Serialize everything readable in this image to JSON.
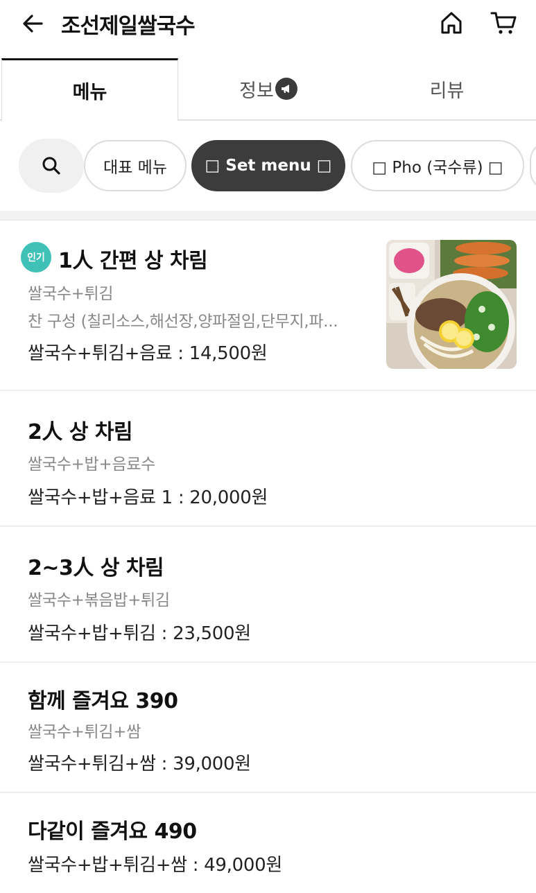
{
  "header": {
    "title": "조선제일쌀국수",
    "back_icon": "arrow-left-icon",
    "home_icon": "home-icon",
    "cart_icon": "cart-icon"
  },
  "tabs": [
    {
      "label": "메뉴",
      "active": true
    },
    {
      "label": "정보",
      "active": false,
      "icon": "megaphone-icon"
    },
    {
      "label": "리뷰",
      "active": false
    }
  ],
  "categories": {
    "search_icon": "search-icon",
    "chips": [
      {
        "label": "대표 메뉴",
        "selected": false
      },
      {
        "label": "□ Set menu □",
        "selected": true
      },
      {
        "label": "□ Pho (국수류) □",
        "selected": false
      }
    ]
  },
  "menu_items": [
    {
      "badge": "인기",
      "name": "1人 간편 상 차림",
      "desc_1": "쌀국수+튀김",
      "desc_2": "찬 구성 (칠리소스,해선장,양파절임,단무지,파...",
      "price": "쌀국수+튀김+음료 : 14,500원",
      "image": "pho-set-photo"
    },
    {
      "name": "2人 상 차림",
      "desc_1": "쌀국수+밥+음료수",
      "price": "쌀국수+밥+음료 1 : 20,000원"
    },
    {
      "name": "2~3人 상 차림",
      "desc_1": "쌀국수+볶음밥+튀김",
      "price": "쌀국수+밥+튀김 : 23,500원"
    },
    {
      "name": "함께 즐겨요 390",
      "desc_1": "쌀국수+튀김+쌈",
      "price": "쌀국수+튀김+쌈 : 39,000원"
    },
    {
      "name": "다같이 즐겨요 490",
      "price": "쌀국수+밥+튀김+쌈 : 49,000원"
    }
  ],
  "colors": {
    "accent_badge": "#3fc1b8",
    "selected_chip": "#3c3c3c",
    "text_secondary": "#888888"
  }
}
